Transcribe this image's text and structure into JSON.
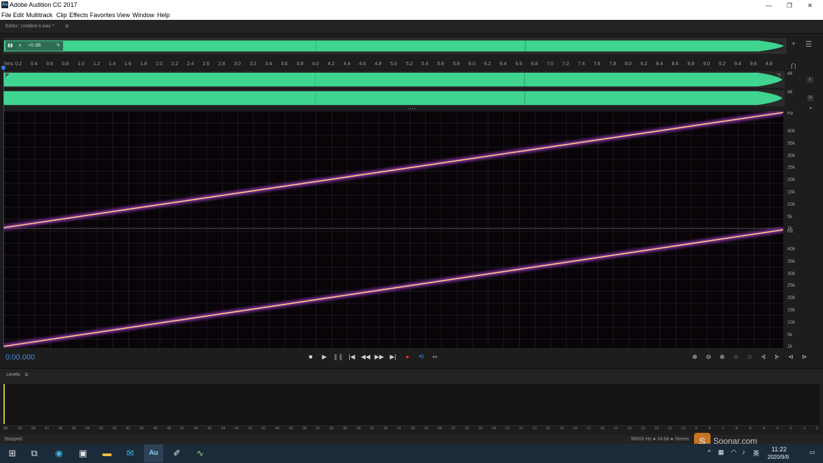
{
  "window": {
    "title": "Adobe Audition CC 2017",
    "app_icon": "Au"
  },
  "menu": [
    "File",
    "Edit",
    "Multitrack",
    "Clip",
    "Effects",
    "Favorites",
    "View",
    "Window",
    "Help"
  ],
  "editor": {
    "tab_label": "Editor: Untitled 4.wav *",
    "menu_glyph": "≡"
  },
  "overview": {
    "hud_value": "+0 dB"
  },
  "ruler": {
    "unit": "hms",
    "ticks": [
      "0.2",
      "0.4",
      "0.6",
      "0.8",
      "1.0",
      "1.2",
      "1.4",
      "1.6",
      "1.8",
      "2.0",
      "2.2",
      "2.4",
      "2.6",
      "2.8",
      "3.0",
      "3.2",
      "3.4",
      "3.6",
      "3.8",
      "4.0",
      "4.2",
      "4.4",
      "4.6",
      "4.8",
      "5.0",
      "5.2",
      "5.4",
      "5.6",
      "5.8",
      "6.0",
      "6.2",
      "6.4",
      "6.6",
      "6.8",
      "7.0",
      "7.2",
      "7.4",
      "7.6",
      "7.8",
      "8.0",
      "8.2",
      "8.4",
      "8.6",
      "8.8",
      "9.0",
      "9.2",
      "9.4",
      "9.6",
      "9.8"
    ]
  },
  "channels": [
    {
      "db": "dB",
      "name": "L"
    },
    {
      "db": "dB",
      "name": "R"
    }
  ],
  "spectral": {
    "unit": "Hz",
    "freq_labels": [
      "40k",
      "35k",
      "30k",
      "25k",
      "20k",
      "15k",
      "10k",
      "5k",
      "1k"
    ],
    "sweep_color": "#ffd27a",
    "glow_color": "#a23cc8"
  },
  "transport": {
    "timecode": "0:00.000",
    "accent": "#3b8fe0"
  },
  "levels": {
    "title": "Levels",
    "scale": [
      "dB",
      "-59",
      "-58",
      "-57",
      "-56",
      "-55",
      "-54",
      "-53",
      "-52",
      "-51",
      "-50",
      "-49",
      "-48",
      "-47",
      "-46",
      "-45",
      "-44",
      "-43",
      "-42",
      "-41",
      "-40",
      "-39",
      "-38",
      "-37",
      "-36",
      "-35",
      "-34",
      "-33",
      "-32",
      "-31",
      "-30",
      "-29",
      "-28",
      "-27",
      "-26",
      "-25",
      "-24",
      "-23",
      "-22",
      "-21",
      "-20",
      "-19",
      "-18",
      "-17",
      "-16",
      "-15",
      "-14",
      "-13",
      "-12",
      "-11",
      "-10",
      "-9",
      "-8",
      "-7",
      "-6",
      "-5",
      "-4",
      "-3",
      "-2",
      "-1",
      "0"
    ]
  },
  "status": {
    "state": "Stopped",
    "info": "96000 Hz ● 24-bit ● Stereo"
  },
  "watermark": {
    "text": "Soonar.com"
  },
  "taskbar": {
    "tray_lang": "英",
    "time": "11:22",
    "date": "2020/9/9"
  },
  "colors": {
    "waveform": "#3fd490",
    "waveform_dark": "#2c9c69",
    "playhead": "#2f7ad6"
  }
}
